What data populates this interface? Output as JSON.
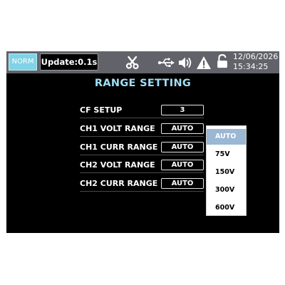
{
  "status_bar": {
    "mode": "NORM",
    "update": "Update:0.1s",
    "icons": [
      "scissors-icon",
      "usb-icon",
      "speaker-icon",
      "warning-icon",
      "unlock-icon"
    ],
    "date": "12/06/2026",
    "time": "15:34:25"
  },
  "page": {
    "title": "RANGE SETTING",
    "rows": [
      {
        "label": "CF SETUP",
        "value": "3"
      },
      {
        "label": "CH1 VOLT RANGE",
        "value": "AUTO"
      },
      {
        "label": "CH1 CURR RANGE",
        "value": "AUTO"
      },
      {
        "label": "CH2 VOLT RANGE",
        "value": "AUTO"
      },
      {
        "label": "CH2 CURR RANGE",
        "value": "AUTO"
      }
    ]
  },
  "dropdown": {
    "selected": "AUTO",
    "options": [
      "AUTO",
      "75V",
      "150V",
      "300V",
      "600V"
    ]
  },
  "colors": {
    "screen_bg": "#000000",
    "status_bar_bg": "#62636a",
    "mode_badge": "#7fd3e6",
    "title_accent": "#9fdff5",
    "selected_option": "#9ab7d3"
  }
}
